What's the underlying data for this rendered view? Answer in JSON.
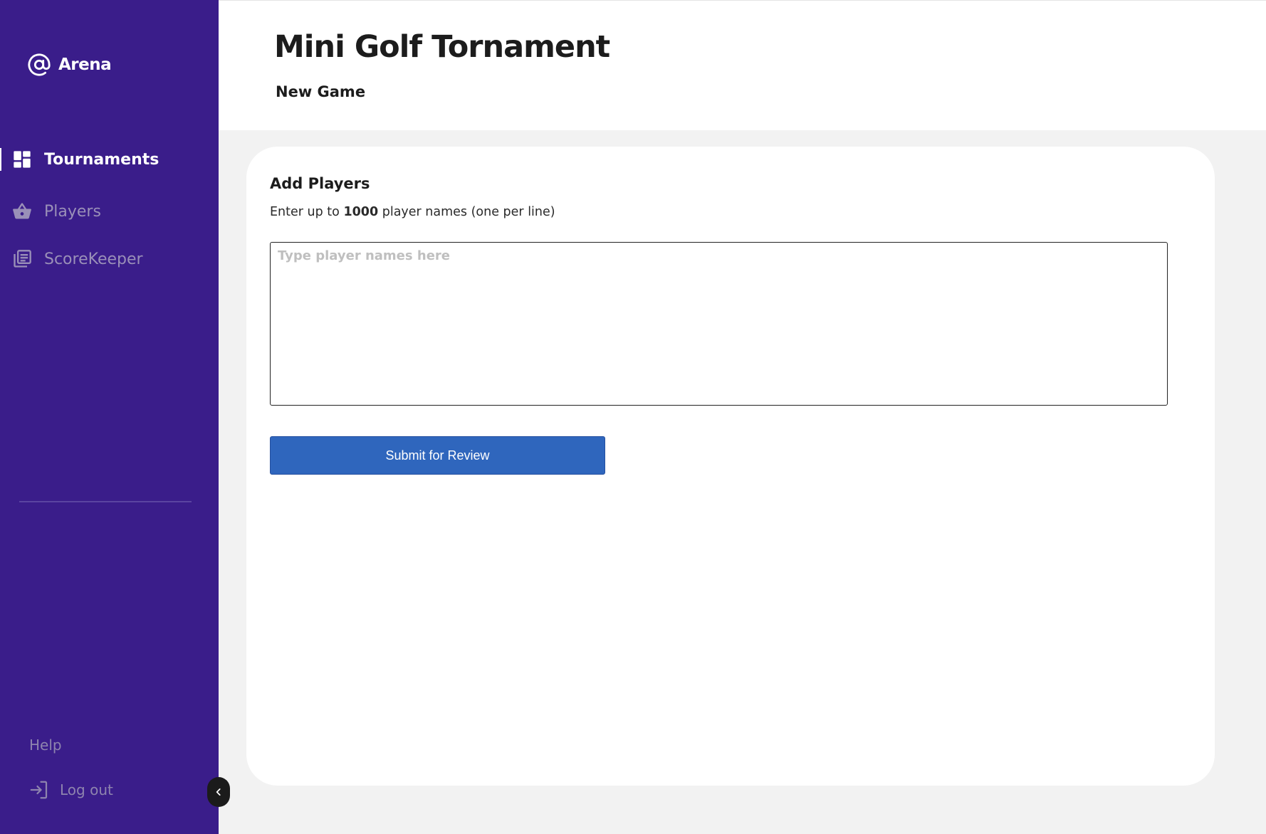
{
  "brand": {
    "name": "Arena",
    "icon": "at-sign-icon"
  },
  "sidebar": {
    "items": [
      {
        "label": "Tournaments",
        "icon": "dashboard-icon",
        "active": true
      },
      {
        "label": "Players",
        "icon": "basket-icon",
        "active": false
      },
      {
        "label": "ScoreKeeper",
        "icon": "library-books-icon",
        "active": false
      }
    ],
    "help_label": "Help",
    "logout_label": "Log out"
  },
  "header": {
    "title": "Mini Golf Tornament",
    "subtitle": "New Game"
  },
  "card": {
    "title": "Add Players",
    "desc_prefix": "Enter up to ",
    "desc_count": "1000",
    "desc_suffix": " player names (one per line)",
    "input_value": "",
    "input_placeholder": "Type player names here",
    "submit_label": "Submit for Review"
  },
  "colors": {
    "sidebar_bg": "#3a1d8a",
    "accent_button": "#2f66bd",
    "page_bg": "#f2f2f2"
  }
}
